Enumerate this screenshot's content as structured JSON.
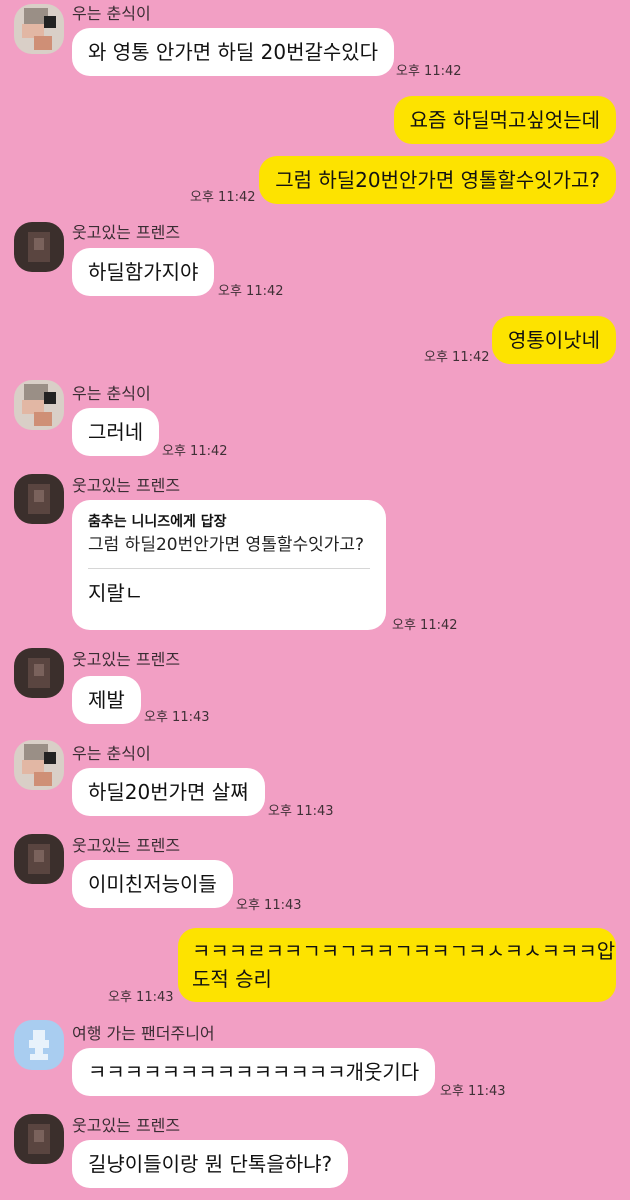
{
  "senders": {
    "s1": "우는 춘식이",
    "s2": "웃고있는 프렌즈",
    "s3": "여행 가는 팬더주니어"
  },
  "messages": [
    {
      "text": "와 영통 안가면 하딜 20번갈수있다",
      "time": "오후 11:42"
    },
    {
      "text": "요즘 하딜먹고싶엇는데"
    },
    {
      "text": "그럼 하딜20번안가면 영톨할수잇가고?",
      "time": "오후 11:42"
    },
    {
      "text": "하딜함가지야",
      "time": "오후 11:42"
    },
    {
      "text": "영통이낫네",
      "time": "오후 11:42"
    },
    {
      "text": "그러네",
      "time": "오후 11:42"
    },
    {
      "reply_to": "춤추는 니니즈에게 답장",
      "quote": "그럼 하딜20번안가면 영톨할수잇가고?",
      "text": "지랄ㄴ",
      "time": "오후 11:42"
    },
    {
      "text": "제발",
      "time": "오후 11:43"
    },
    {
      "text": "하딜20번가면 살쪄",
      "time": "오후 11:43"
    },
    {
      "text": "이미친저능이들",
      "time": "오후 11:43"
    },
    {
      "line1": "ㅋㅋㅋㄹㅋㅋㄱㅋㄱㅋㅋㄱㅋㅋㄱㅋㅅㅋㅅㅋㅋㅋ압",
      "line2": "도적 승리",
      "time": "오후 11:43"
    },
    {
      "text": "ㅋㅋㅋㅋㅋㅋㅋㅋㅋㅋㅋㅋㅋㅋ개웃기다",
      "time": "오후 11:43"
    },
    {
      "text": "길냥이들이랑 뭔 단톡을하냐?"
    }
  ],
  "colors": {
    "background": "#f29fc4",
    "my_bubble": "#fde300",
    "other_bubble": "#ffffff"
  }
}
